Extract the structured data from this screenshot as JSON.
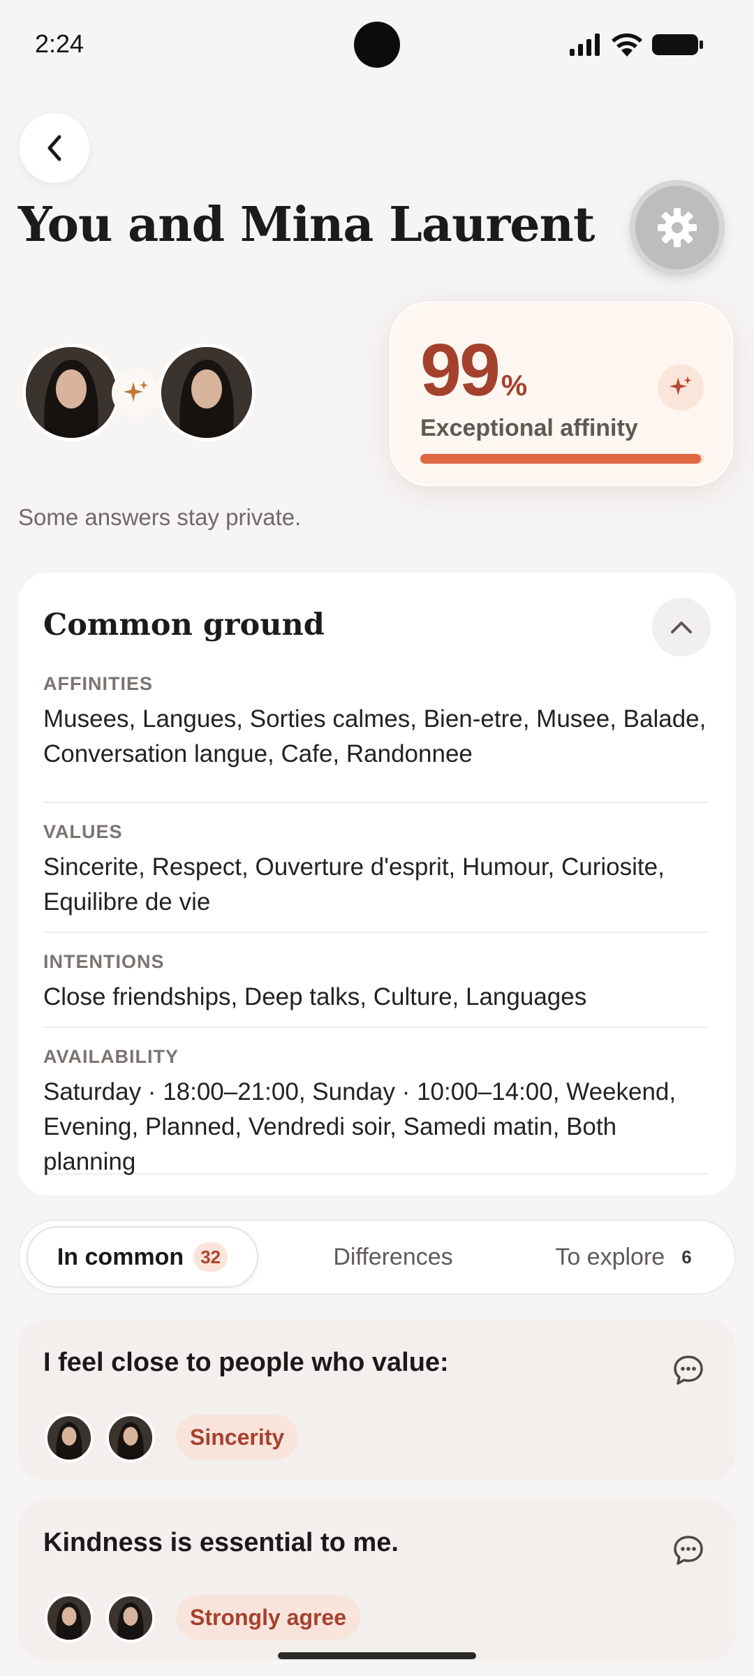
{
  "status_bar": {
    "time": "2:24"
  },
  "header": {
    "title": "You and Mina Laurent"
  },
  "affinity": {
    "percent": "99",
    "unit": "%",
    "label": "Exceptional affinity",
    "level_fraction": 0.99
  },
  "privacy_note": "Some answers stay private.",
  "common_ground": {
    "title": "Common ground",
    "sections": [
      {
        "label": "AFFINITIES",
        "text": "Musees, Langues, Sorties calmes, Bien-etre, Musee, Balade, Conversation langue, Cafe, Randonnee"
      },
      {
        "label": "VALUES",
        "text": "Sincerite, Respect, Ouverture d'esprit, Humour, Curiosite, Equilibre de vie"
      },
      {
        "label": "INTENTIONS",
        "text": "Close friendships, Deep talks, Culture, Languages"
      },
      {
        "label": "AVAILABILITY",
        "text": "Saturday · 18:00–21:00, Sunday · 10:00–14:00, Weekend, Evening, Planned, Vendredi soir, Samedi matin, Both planning"
      }
    ]
  },
  "tabs": [
    {
      "label": "In common",
      "count": "32"
    },
    {
      "label": "Differences"
    },
    {
      "label": "To explore",
      "count": "6"
    }
  ],
  "questions": [
    {
      "text": "I feel close to people who value:",
      "answer": "Sincerity"
    },
    {
      "text": "Kindness is essential to me.",
      "answer": "Strongly agree"
    }
  ],
  "colors": {
    "accent": "#a4412d",
    "bar": "#e16a44",
    "background": "#f6f5f4"
  },
  "icons": {
    "back": "chevron-left-icon",
    "settings": "gear-icon",
    "sparkle": "sparkles-icon",
    "collapse": "chevron-up-icon",
    "comment": "chat-bubble-icon"
  }
}
